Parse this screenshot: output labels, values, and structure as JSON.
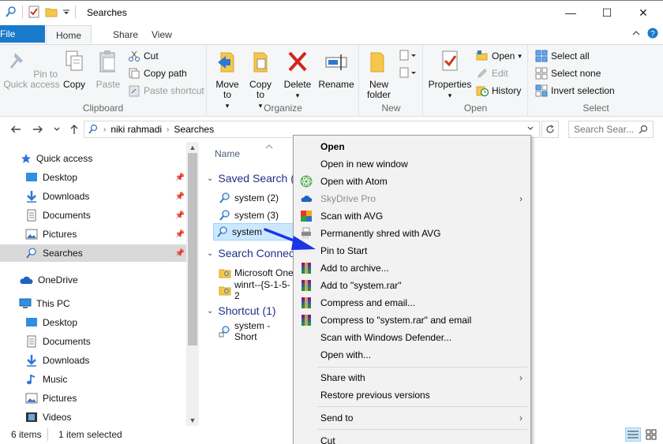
{
  "window": {
    "title": "Searches",
    "controls": {
      "minimize": "—",
      "maximize": "☐",
      "close": "✕"
    }
  },
  "ribbon_tabs": {
    "file": "File",
    "home": "Home",
    "share": "Share",
    "view": "View"
  },
  "ribbon": {
    "clipboard": {
      "label": "Clipboard",
      "pin_to_quick_access": "Pin to Quick access",
      "copy": "Copy",
      "paste": "Paste",
      "cut": "Cut",
      "copy_path": "Copy path",
      "paste_shortcut": "Paste shortcut"
    },
    "organize": {
      "label": "Organize",
      "move_to": "Move to",
      "copy_to": "Copy to",
      "delete": "Delete",
      "rename": "Rename"
    },
    "new": {
      "label": "New",
      "new_folder": "New folder"
    },
    "open": {
      "label": "Open",
      "properties": "Properties",
      "open": "Open",
      "edit": "Edit",
      "history": "History"
    },
    "select": {
      "label": "Select",
      "select_all": "Select all",
      "select_none": "Select none",
      "invert_selection": "Invert selection"
    }
  },
  "address": {
    "breadcrumbs": [
      "niki rahmadi",
      "Searches"
    ],
    "search_placeholder": "Search Sear..."
  },
  "nav_pane": {
    "quick_access": "Quick access",
    "quick_items": [
      "Desktop",
      "Downloads",
      "Documents",
      "Pictures",
      "Searches"
    ],
    "onedrive": "OneDrive",
    "this_pc": "This PC",
    "pc_items": [
      "Desktop",
      "Documents",
      "Downloads",
      "Music",
      "Pictures",
      "Videos"
    ]
  },
  "content": {
    "column_name": "Name",
    "groups": [
      {
        "title": "Saved Search (",
        "files": [
          "system (2)",
          "system (3)",
          "system"
        ]
      },
      {
        "title": "Search Connec",
        "files": [
          "Microsoft One",
          "winrt--{S-1-5-2"
        ]
      },
      {
        "title": "Shortcut (1)",
        "files": [
          "system - Short"
        ]
      }
    ]
  },
  "status": {
    "item_count": "6 items",
    "selected": "1 item selected"
  },
  "context_menu": {
    "items": [
      "Open",
      "Open in new window",
      "Open with Atom",
      "SkyDrive Pro",
      "Scan with AVG",
      "Permanently shred with AVG",
      "Pin to Start",
      "Add to archive...",
      "Add to \"system.rar\"",
      "Compress and email...",
      "Compress to \"system.rar\" and email",
      "Scan with Windows Defender...",
      "Open with...",
      "Share with",
      "Restore previous versions",
      "Send to",
      "Cut"
    ]
  },
  "colors": {
    "accent": "#1979ca",
    "arrow": "#1a35e6",
    "selection": "#cce8ff"
  }
}
